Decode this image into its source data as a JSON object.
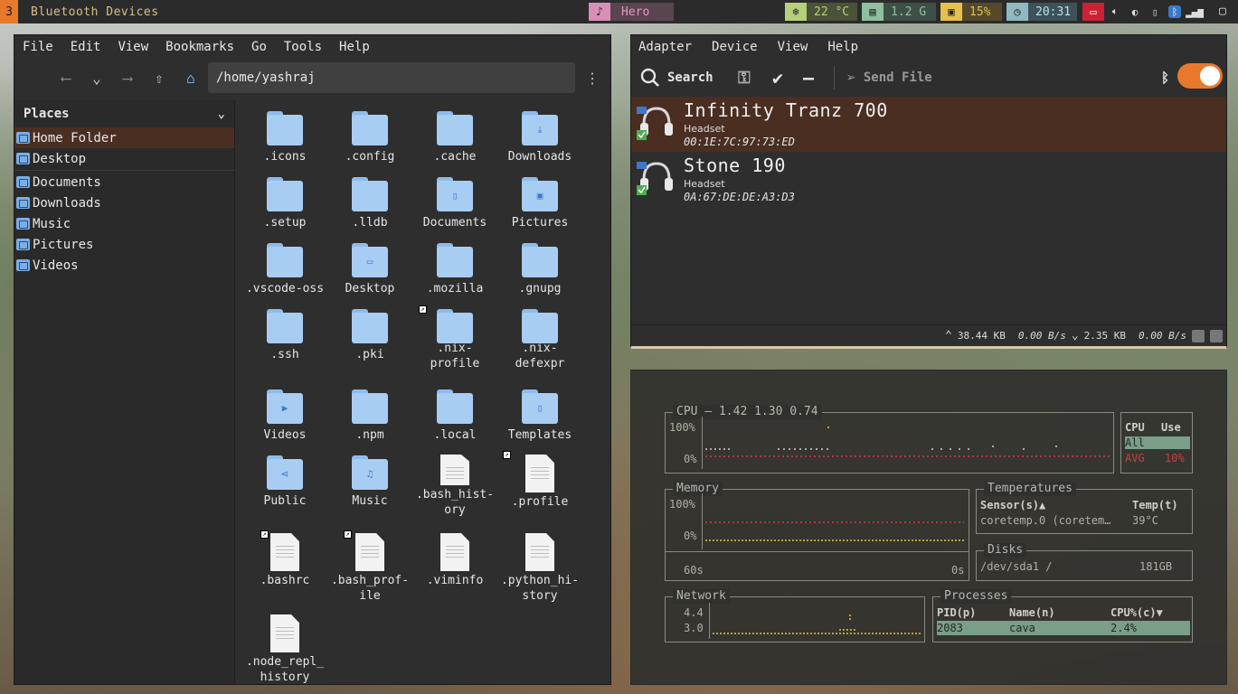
{
  "topbar": {
    "workspace": "3",
    "window_title": "Bluetooth Devices",
    "media_title": "Hero",
    "temperature": "22 °C",
    "memory": "1.2 G",
    "cpu": "15%",
    "clock": "20:31",
    "colors": {
      "accent": "#e8792b",
      "temp": "#b5cf7a",
      "mem": "#8fbf9f",
      "cpu": "#e6c04a",
      "clock": "#8fb8c0",
      "alert": "#cc2233"
    }
  },
  "file_manager": {
    "menu": [
      "File",
      "Edit",
      "View",
      "Bookmarks",
      "Go",
      "Tools",
      "Help"
    ],
    "path": "/home/yashraj",
    "places_title": "Places",
    "places": [
      "Home Folder",
      "Desktop",
      "Documents",
      "Downloads",
      "Music",
      "Pictures",
      "Videos"
    ],
    "active_place": "Home Folder",
    "files": [
      {
        "name": ".icons",
        "type": "folder"
      },
      {
        "name": ".config",
        "type": "folder"
      },
      {
        "name": ".cache",
        "type": "folder"
      },
      {
        "name": "Downloads",
        "type": "folder",
        "emblem": "download-icon"
      },
      {
        "name": ".setup",
        "type": "folder"
      },
      {
        "name": ".lldb",
        "type": "folder"
      },
      {
        "name": "Documents",
        "type": "folder",
        "emblem": "document-icon"
      },
      {
        "name": "Pictures",
        "type": "folder",
        "emblem": "image-icon"
      },
      {
        "name": ".vscode-oss",
        "type": "folder"
      },
      {
        "name": "Desktop",
        "type": "folder",
        "emblem": "desktop-icon"
      },
      {
        "name": ".mozilla",
        "type": "folder"
      },
      {
        "name": ".gnupg",
        "type": "folder"
      },
      {
        "name": ".ssh",
        "type": "folder"
      },
      {
        "name": ".pki",
        "type": "folder"
      },
      {
        "name": ".nix-profile",
        "type": "folder",
        "symlink": true
      },
      {
        "name": ".nix-defexpr",
        "type": "folder"
      },
      {
        "name": "Videos",
        "type": "folder",
        "emblem": "video-icon"
      },
      {
        "name": ".npm",
        "type": "folder"
      },
      {
        "name": ".local",
        "type": "folder"
      },
      {
        "name": "Templates",
        "type": "folder",
        "emblem": "template-icon"
      },
      {
        "name": "Public",
        "type": "folder",
        "emblem": "share-icon"
      },
      {
        "name": "Music",
        "type": "folder",
        "emblem": "music-icon"
      },
      {
        "name": ".bash_history",
        "type": "file"
      },
      {
        "name": ".profile",
        "type": "file",
        "symlink": true
      },
      {
        "name": ".bashrc",
        "type": "file",
        "symlink": true
      },
      {
        "name": ".bash_profile",
        "type": "file",
        "symlink": true
      },
      {
        "name": ".viminfo",
        "type": "file"
      },
      {
        "name": ".python_history",
        "type": "file"
      },
      {
        "name": ".node_repl_history",
        "type": "file"
      }
    ],
    "labels": {
      "f0": ".icons",
      "f1": ".config",
      "f2": ".cache",
      "f3": "Downloads",
      "f4": ".setup",
      "f5": ".lldb",
      "f6": "Documents",
      "f7": "Pictures",
      "f8": ".vscode-oss",
      "f9": "Desktop",
      "f10": ".mozilla",
      "f11": ".gnupg",
      "f12": ".ssh",
      "f13": ".pki",
      "f14a": ".nix-",
      "f14b": "profile",
      "f15a": ".nix-",
      "f15b": "defexpr",
      "f16": "Videos",
      "f17": ".npm",
      "f18": ".local",
      "f19": "Templates",
      "f20": "Public",
      "f21": "Music",
      "f22a": ".bash_hist-",
      "f22b": "ory",
      "f23": ".profile",
      "f24": ".bashrc",
      "f25a": ".bash_prof-",
      "f25b": "ile",
      "f26": ".viminfo",
      "f27a": ".python_hi-",
      "f27b": "story",
      "f28a": ".node_repl_",
      "f28b": "history"
    }
  },
  "bluetooth": {
    "menu": [
      "Adapter",
      "Device",
      "View",
      "Help"
    ],
    "search_label": "Search",
    "send_file_label": "Send File",
    "powered": true,
    "devices": [
      {
        "name": "Infinity Tranz 700",
        "type": "Headset",
        "mac": "00:1E:7C:97:73:ED",
        "selected": true
      },
      {
        "name": "Stone 190",
        "type": "Headset",
        "mac": "0A:67:DE:DE:A3:D3",
        "selected": false
      }
    ],
    "status": {
      "up_total": "38.44 KB",
      "up_rate": "0.00 B/s",
      "down_total": "2.35 KB",
      "down_rate": "0.00 B/s"
    }
  },
  "monitor": {
    "cpu_title": "CPU — 1.42 1.30 0.74",
    "cpu_max": "100%",
    "cpu_min": "0%",
    "cpu_table": {
      "col1": "CPU",
      "col2": "Use",
      "row_all": "All",
      "avg_label": "AVG",
      "avg_value": "10%"
    },
    "memory_title": "Memory",
    "mem_max": "100%",
    "mem_min": "0%",
    "mem_left": "60s",
    "mem_right": "0s",
    "temps_title": "Temperatures",
    "temps_col1": "Sensor(s)▲",
    "temps_col2": "Temp(t)",
    "temps_sensor": "coretemp.0 (coretem…",
    "temps_value": "39°C",
    "disks_title": "Disks",
    "disk_name": "/dev/sda1 /",
    "disk_size": "181GB",
    "network_title": "Network",
    "net_top": "4.4",
    "net_bottom": "3.0",
    "proc_title": "Processes",
    "proc_col1": "PID(p)",
    "proc_col2": "Name(n)",
    "proc_col3": "CPU%(c)▼",
    "proc_pid": "2083",
    "proc_name": "cava",
    "proc_cpu": "2.4%"
  }
}
